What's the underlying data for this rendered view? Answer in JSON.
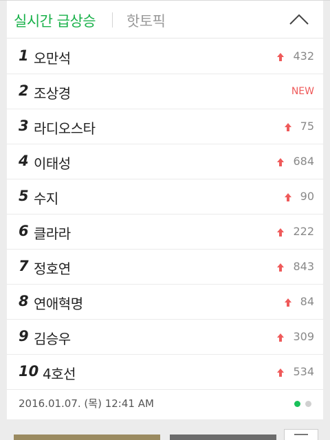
{
  "tabs": {
    "active": "실시간 급상승",
    "inactive": "핫토픽"
  },
  "ranking": [
    {
      "rank": "1",
      "keyword": "오만석",
      "change": "432",
      "status": "up"
    },
    {
      "rank": "2",
      "keyword": "조상경",
      "change": "NEW",
      "status": "new"
    },
    {
      "rank": "3",
      "keyword": "라디오스타",
      "change": "75",
      "status": "up"
    },
    {
      "rank": "4",
      "keyword": "이태성",
      "change": "684",
      "status": "up"
    },
    {
      "rank": "5",
      "keyword": "수지",
      "change": "90",
      "status": "up"
    },
    {
      "rank": "6",
      "keyword": "클라라",
      "change": "222",
      "status": "up"
    },
    {
      "rank": "7",
      "keyword": "정호연",
      "change": "843",
      "status": "up"
    },
    {
      "rank": "8",
      "keyword": "연애혁명",
      "change": "84",
      "status": "up"
    },
    {
      "rank": "9",
      "keyword": "김승우",
      "change": "309",
      "status": "up"
    },
    {
      "rank": "10",
      "keyword": "4호선",
      "change": "534",
      "status": "up"
    }
  ],
  "footer": {
    "timestamp": "2016.01.07. (목) 12:41 AM",
    "page_indicator": {
      "current": 1,
      "total": 2
    }
  },
  "colors": {
    "accent": "#19b14a",
    "up_arrow": "#ef5a5a",
    "new_badge": "#ef5a5a"
  },
  "icons": {
    "collapse": "chevron-up-icon",
    "rank_up": "arrow-up-icon"
  }
}
